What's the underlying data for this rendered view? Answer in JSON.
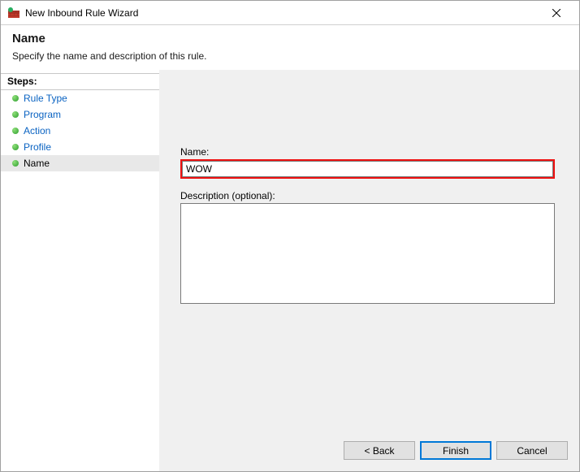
{
  "window": {
    "title": "New Inbound Rule Wizard"
  },
  "header": {
    "title": "Name",
    "subtitle": "Specify the name and description of this rule."
  },
  "sidebar": {
    "header": "Steps:",
    "items": [
      {
        "label": "Rule Type",
        "active": false
      },
      {
        "label": "Program",
        "active": false
      },
      {
        "label": "Action",
        "active": false
      },
      {
        "label": "Profile",
        "active": false
      },
      {
        "label": "Name",
        "active": true
      }
    ]
  },
  "form": {
    "name_label": "Name:",
    "name_value": "WOW",
    "desc_label": "Description (optional):",
    "desc_value": ""
  },
  "buttons": {
    "back": "< Back",
    "finish": "Finish",
    "cancel": "Cancel"
  }
}
